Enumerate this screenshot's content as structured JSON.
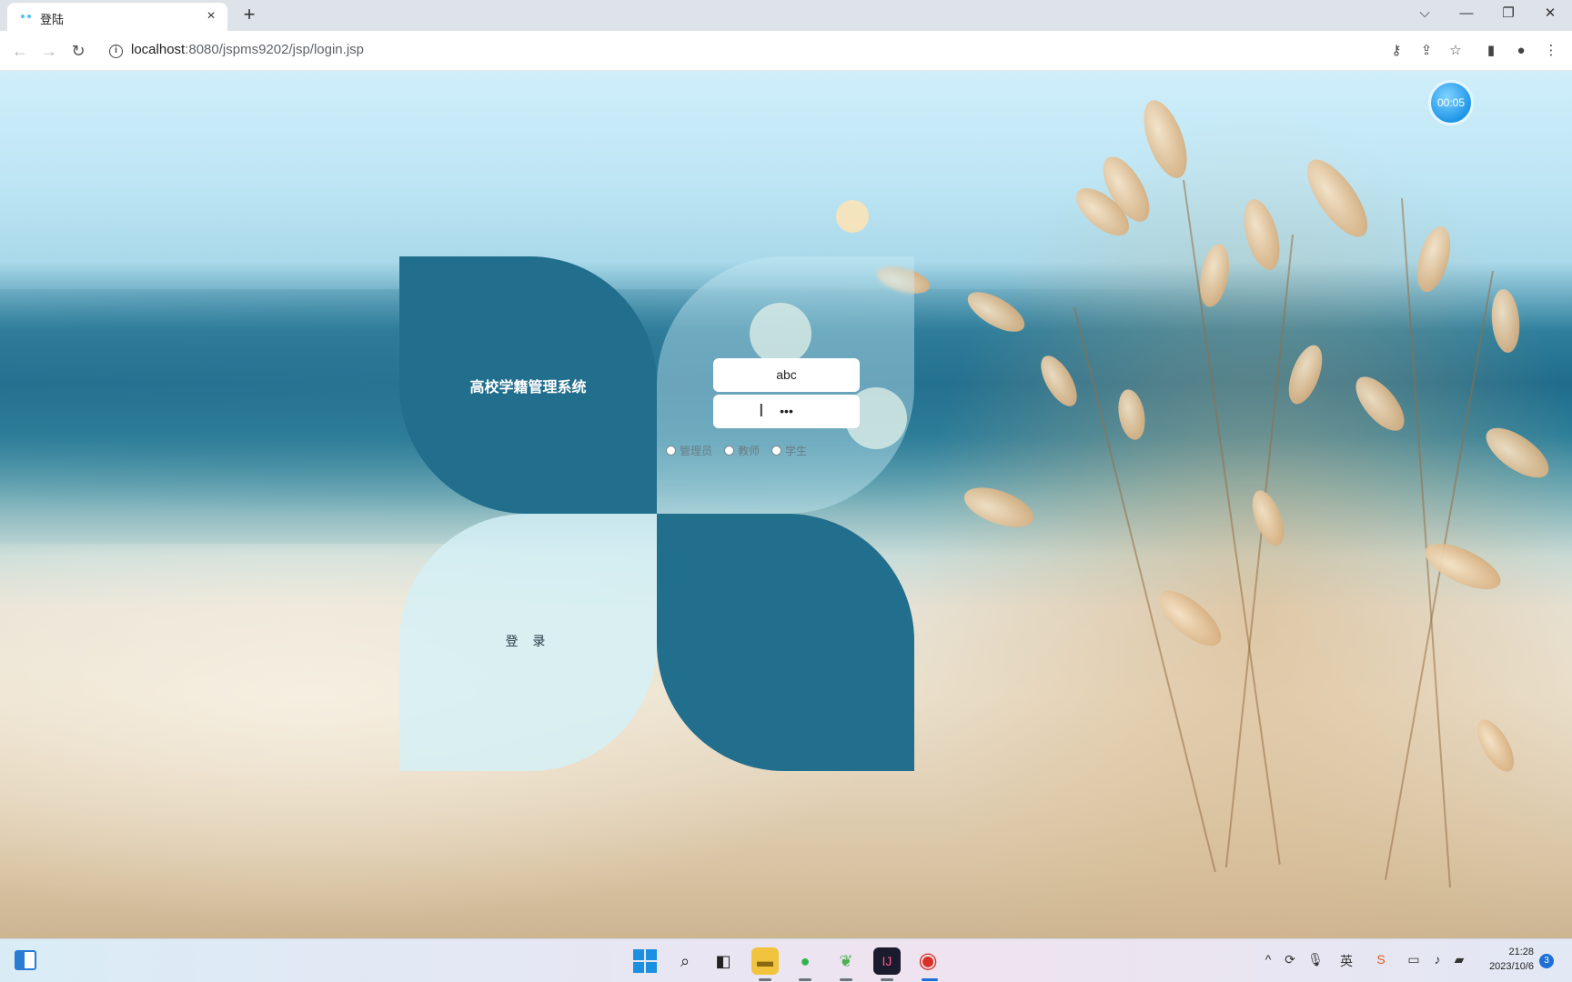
{
  "browser": {
    "tab_title": "登陆",
    "tab_close": "×",
    "new_tab": "+",
    "url_host": "localhost",
    "url_rest": ":8080/jspms9202/jsp/login.jsp",
    "window_controls": [
      "⌵",
      "—",
      "❐",
      "✕"
    ]
  },
  "page": {
    "timer": "00:05",
    "system_title": "高校学籍管理系统",
    "username_value": "abc",
    "password_value": "•••",
    "roles": [
      "管理员",
      "教师",
      "学生"
    ],
    "login_button": "登 录"
  },
  "taskbar": {
    "clock_time": "21:28",
    "clock_date": "2023/10/6",
    "notification_count": "3"
  },
  "colors": {
    "petal_dark": "#226e8d",
    "petal_light": "#d4f0f6",
    "accent_timer": "#1f96e8"
  }
}
